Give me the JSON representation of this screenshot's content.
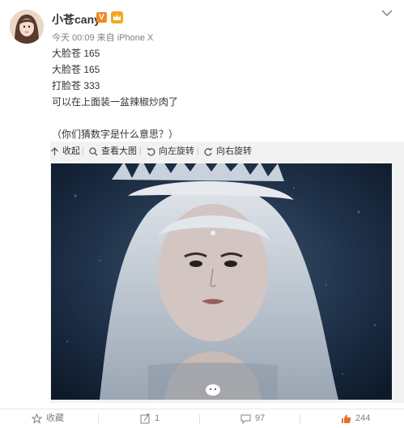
{
  "user": {
    "name": "小苍cany",
    "verified_badge": "V",
    "member_icon": "crown-member-icon",
    "time": "今天 00:09",
    "source_prefix": "来自",
    "source": "iPhone X"
  },
  "post": {
    "lines": [
      "大脸苍 165",
      "大脸苍 165",
      "打脸苍 333",
      "可以在上面装一盆辣椒炒肉了",
      "",
      "（你们猜数字是什么意思？）"
    ]
  },
  "media_toolbar": {
    "collapse": "收起",
    "view_large": "查看大图",
    "rotate_left": "向左旋转",
    "rotate_right": "向右旋转"
  },
  "footer": {
    "favorite": "收藏",
    "repost_count": "1",
    "comment_count": "97",
    "like_count": "244"
  },
  "colors": {
    "accent_orange": "#f08a24",
    "text_main": "#333333",
    "text_meta": "#808080",
    "like_orange": "#e8702a"
  }
}
